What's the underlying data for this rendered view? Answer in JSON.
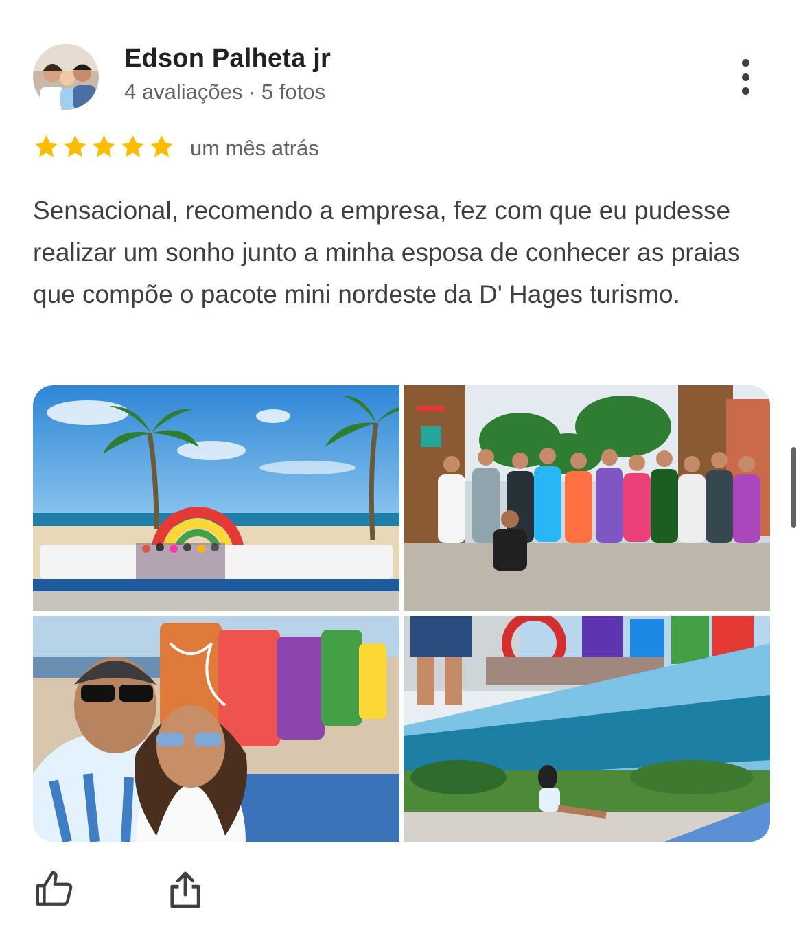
{
  "review": {
    "author_name": "Edson Palheta jr",
    "author_meta": "4 avaliações · 5 fotos",
    "rating": 5,
    "time_ago": "um mês atrás",
    "text": "Sensacional, recomendo a empresa, fez com que eu pudesse realizar um sonho junto a minha esposa de conhecer as praias que compõe o pacote mini nordeste da D' Hages turismo.",
    "star_color": "#fbbc04",
    "photos": [
      {
        "icon": "beach-sign-photo"
      },
      {
        "icon": "group-street-photo"
      },
      {
        "icon": "selfie-sign-photo"
      },
      {
        "icon": "ocean-view-photo"
      }
    ]
  },
  "actions": {
    "like_icon": "thumbs-up-icon",
    "share_icon": "share-icon",
    "more_icon": "more-vertical-icon"
  }
}
